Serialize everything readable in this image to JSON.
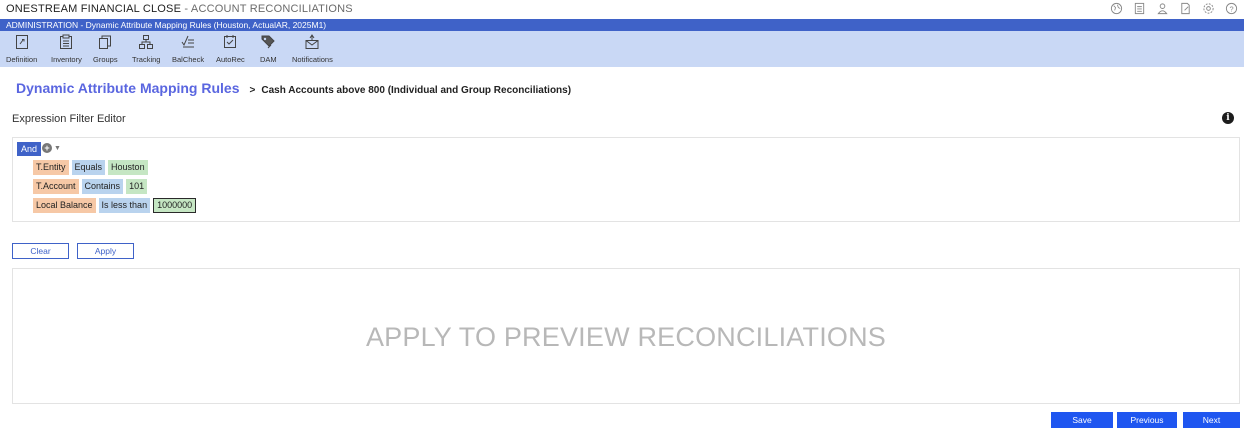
{
  "app": {
    "title_main": "ONESTREAM FINANCIAL CLOSE",
    "title_sep": " - ",
    "title_sub": "ACCOUNT RECONCILIATIONS"
  },
  "top_icons": [
    "globe-icon",
    "document-list-icon",
    "user-icon",
    "document-edit-icon",
    "gear-icon",
    "help-icon"
  ],
  "admin_bar": {
    "text": "ADMINISTRATION - Dynamic Attribute Mapping Rules (Houston, ActualAR, 2025M1)"
  },
  "toolbar": {
    "items": [
      {
        "label": "Definition",
        "icon": "definition-icon"
      },
      {
        "label": "Inventory",
        "icon": "inventory-icon"
      },
      {
        "label": "Groups",
        "icon": "groups-icon"
      },
      {
        "label": "Tracking",
        "icon": "tracking-icon"
      },
      {
        "label": "BalCheck",
        "icon": "balcheck-icon"
      },
      {
        "label": "AutoRec",
        "icon": "autorec-icon"
      },
      {
        "label": "DAM",
        "icon": "dam-icon"
      },
      {
        "label": "Notifications",
        "icon": "notifications-icon"
      }
    ]
  },
  "breadcrumb": {
    "root": "Dynamic Attribute Mapping Rules",
    "separator": ">",
    "current": "Cash Accounts above 800 (Individual and Group Reconciliations)"
  },
  "editor": {
    "title": "Expression Filter Editor",
    "group_operator": "And",
    "add_icon": "add-condition-icon",
    "conditions": [
      {
        "field": "T.Entity",
        "operator": "Equals",
        "value": "Houston"
      },
      {
        "field": "T.Account",
        "operator": "Contains",
        "value": "101"
      },
      {
        "field": "Local Balance",
        "operator": "Is less than",
        "value": "1000000"
      }
    ]
  },
  "actions": {
    "clear_label": "Clear",
    "apply_label": "Apply"
  },
  "preview": {
    "message": "APPLY TO PREVIEW RECONCILIATIONS"
  },
  "footer": {
    "save_label": "Save",
    "previous_label": "Previous",
    "next_label": "Next"
  },
  "colors": {
    "admin_band": "#3f62c8",
    "toolbar": "#c9d8f5",
    "accent": "#5a66e0",
    "primary_button": "#1f56f0",
    "field_chip": "#f6c8a6",
    "operator_chip": "#b9d3ee",
    "value_chip": "#c5e6c3"
  }
}
